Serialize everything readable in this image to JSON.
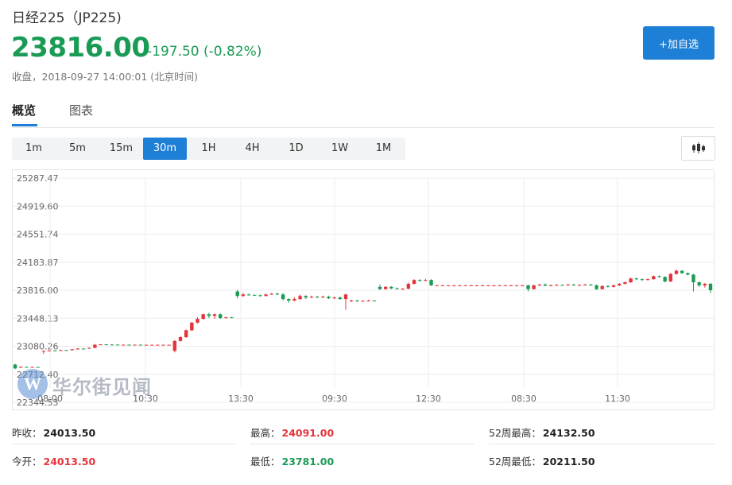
{
  "header": {
    "title": "日经225（JP225)",
    "price": "23816.00",
    "change": "-197.50 (-0.82%)",
    "status_label": "收盘，",
    "timestamp": "2018-09-27 14:00:01",
    "timezone": "(北京时间)",
    "add_watch_label": "+加自选",
    "change_color": "#1a9b55",
    "accent_color": "#1e7fd6"
  },
  "tabs": [
    {
      "label": "概览",
      "active": true
    },
    {
      "label": "图表",
      "active": false
    }
  ],
  "periods": [
    "1m",
    "5m",
    "15m",
    "30m",
    "1H",
    "4H",
    "1D",
    "1W",
    "1M"
  ],
  "active_period": "30m",
  "chart_type_icon": "candlestick-icon",
  "watermark": {
    "logo_letter": "W",
    "text": "华尔街见闻"
  },
  "chart_data": {
    "type": "candlestick",
    "y_ticks": [
      "25287.47",
      "24919.60",
      "24551.74",
      "24183.87",
      "23816.00",
      "23448.13",
      "23080.26",
      "22712.40",
      "22344.53"
    ],
    "ylim": [
      22344.53,
      25287.47
    ],
    "x_ticks": [
      "08:00",
      "10:30",
      "13:30",
      "09:30",
      "12:30",
      "08:30",
      "11:30"
    ],
    "grid": true,
    "up_color": "#e5343b",
    "down_color": "#1a9b55",
    "candles": [
      {
        "o": 22840,
        "c": 22790,
        "h": 22850,
        "l": 22780
      },
      {
        "o": 22800,
        "c": 22810,
        "h": 22815,
        "l": 22795
      },
      {
        "o": 22810,
        "c": 22805,
        "h": 22812,
        "l": 22800
      },
      {
        "o": 22805,
        "c": 22808,
        "h": 22810,
        "l": 22802
      },
      {
        "o": 22808,
        "c": 22806,
        "h": 22810,
        "l": 22804
      },
      {
        "o": 23010,
        "c": 23020,
        "h": 23025,
        "l": 22980
      },
      {
        "o": 23020,
        "c": 23025,
        "h": 23030,
        "l": 23015
      },
      {
        "o": 23025,
        "c": 23022,
        "h": 23028,
        "l": 23018
      },
      {
        "o": 23022,
        "c": 23030,
        "h": 23035,
        "l": 23020
      },
      {
        "o": 23030,
        "c": 23028,
        "h": 23032,
        "l": 23025
      },
      {
        "o": 23028,
        "c": 23040,
        "h": 23045,
        "l": 23025
      },
      {
        "o": 23040,
        "c": 23050,
        "h": 23055,
        "l": 23035
      },
      {
        "o": 23050,
        "c": 23040,
        "h": 23055,
        "l": 23038
      },
      {
        "o": 23050,
        "c": 23060,
        "h": 23065,
        "l": 23045
      },
      {
        "o": 23060,
        "c": 23100,
        "h": 23110,
        "l": 23055
      },
      {
        "o": 23100,
        "c": 23105,
        "h": 23108,
        "l": 23098
      },
      {
        "o": 23105,
        "c": 23103,
        "h": 23107,
        "l": 23100
      },
      {
        "o": 23103,
        "c": 23102,
        "h": 23105,
        "l": 23100
      },
      {
        "o": 23102,
        "c": 23100,
        "h": 23104,
        "l": 23098
      },
      {
        "o": 23100,
        "c": 23101,
        "h": 23103,
        "l": 23099
      },
      {
        "o": 23101,
        "c": 23100,
        "h": 23103,
        "l": 23098
      },
      {
        "o": 23100,
        "c": 23101,
        "h": 23102,
        "l": 23099
      },
      {
        "o": 23101,
        "c": 23100,
        "h": 23102,
        "l": 23099
      },
      {
        "o": 23100,
        "c": 23100,
        "h": 23101,
        "l": 23099
      },
      {
        "o": 23100,
        "c": 23100,
        "h": 23101,
        "l": 23099
      },
      {
        "o": 23100,
        "c": 23100,
        "h": 23101,
        "l": 23099
      },
      {
        "o": 23100,
        "c": 23100,
        "h": 23101,
        "l": 23099
      },
      {
        "o": 23100,
        "c": 23100,
        "h": 23101,
        "l": 23099
      },
      {
        "o": 23020,
        "c": 23150,
        "h": 23160,
        "l": 23000
      },
      {
        "o": 23150,
        "c": 23200,
        "h": 23210,
        "l": 23140
      },
      {
        "o": 23200,
        "c": 23290,
        "h": 23300,
        "l": 23190
      },
      {
        "o": 23290,
        "c": 23390,
        "h": 23400,
        "l": 23280
      },
      {
        "o": 23390,
        "c": 23440,
        "h": 23460,
        "l": 23380
      },
      {
        "o": 23440,
        "c": 23500,
        "h": 23510,
        "l": 23430
      },
      {
        "o": 23500,
        "c": 23480,
        "h": 23520,
        "l": 23450
      },
      {
        "o": 23480,
        "c": 23500,
        "h": 23510,
        "l": 23440
      },
      {
        "o": 23500,
        "c": 23450,
        "h": 23510,
        "l": 23440
      },
      {
        "o": 23450,
        "c": 23460,
        "h": 23465,
        "l": 23445
      },
      {
        "o": 23460,
        "c": 23455,
        "h": 23465,
        "l": 23450
      },
      {
        "o": 23800,
        "c": 23740,
        "h": 23820,
        "l": 23710
      },
      {
        "o": 23740,
        "c": 23760,
        "h": 23780,
        "l": 23730
      },
      {
        "o": 23760,
        "c": 23755,
        "h": 23770,
        "l": 23745
      },
      {
        "o": 23755,
        "c": 23750,
        "h": 23760,
        "l": 23740
      },
      {
        "o": 23750,
        "c": 23740,
        "h": 23760,
        "l": 23730
      },
      {
        "o": 23740,
        "c": 23760,
        "h": 23770,
        "l": 23735
      },
      {
        "o": 23760,
        "c": 23770,
        "h": 23780,
        "l": 23755
      },
      {
        "o": 23770,
        "c": 23760,
        "h": 23785,
        "l": 23755
      },
      {
        "o": 23760,
        "c": 23700,
        "h": 23780,
        "l": 23680
      },
      {
        "o": 23700,
        "c": 23680,
        "h": 23710,
        "l": 23650
      },
      {
        "o": 23680,
        "c": 23700,
        "h": 23720,
        "l": 23670
      },
      {
        "o": 23700,
        "c": 23740,
        "h": 23760,
        "l": 23690
      },
      {
        "o": 23740,
        "c": 23720,
        "h": 23750,
        "l": 23700
      },
      {
        "o": 23720,
        "c": 23730,
        "h": 23745,
        "l": 23710
      },
      {
        "o": 23730,
        "c": 23725,
        "h": 23740,
        "l": 23715
      },
      {
        "o": 23725,
        "c": 23730,
        "h": 23745,
        "l": 23715
      },
      {
        "o": 23730,
        "c": 23710,
        "h": 23745,
        "l": 23700
      },
      {
        "o": 23710,
        "c": 23720,
        "h": 23730,
        "l": 23700
      },
      {
        "o": 23720,
        "c": 23700,
        "h": 23735,
        "l": 23690
      },
      {
        "o": 23700,
        "c": 23760,
        "h": 23770,
        "l": 23560
      },
      {
        "o": 23670,
        "c": 23680,
        "h": 23690,
        "l": 23660
      },
      {
        "o": 23680,
        "c": 23670,
        "h": 23690,
        "l": 23665
      },
      {
        "o": 23670,
        "c": 23675,
        "h": 23685,
        "l": 23665
      },
      {
        "o": 23675,
        "c": 23680,
        "h": 23690,
        "l": 23670
      },
      {
        "o": 23680,
        "c": 23678,
        "h": 23685,
        "l": 23675
      },
      {
        "o": 23860,
        "c": 23830,
        "h": 23890,
        "l": 23820
      },
      {
        "o": 23830,
        "c": 23860,
        "h": 23870,
        "l": 23825
      },
      {
        "o": 23860,
        "c": 23840,
        "h": 23870,
        "l": 23830
      },
      {
        "o": 23840,
        "c": 23830,
        "h": 23850,
        "l": 23825
      },
      {
        "o": 23830,
        "c": 23835,
        "h": 23845,
        "l": 23825
      },
      {
        "o": 23835,
        "c": 23900,
        "h": 23915,
        "l": 23830
      },
      {
        "o": 23900,
        "c": 23950,
        "h": 23960,
        "l": 23890
      },
      {
        "o": 23950,
        "c": 23940,
        "h": 23960,
        "l": 23930
      },
      {
        "o": 23940,
        "c": 23950,
        "h": 23965,
        "l": 23935
      },
      {
        "o": 23950,
        "c": 23880,
        "h": 23960,
        "l": 23870
      },
      {
        "o": 23880,
        "c": 23880,
        "h": 23885,
        "l": 23875
      },
      {
        "o": 23880,
        "c": 23880,
        "h": 23885,
        "l": 23875
      },
      {
        "o": 23880,
        "c": 23880,
        "h": 23885,
        "l": 23875
      },
      {
        "o": 23880,
        "c": 23880,
        "h": 23885,
        "l": 23875
      },
      {
        "o": 23880,
        "c": 23880,
        "h": 23885,
        "l": 23875
      },
      {
        "o": 23880,
        "c": 23880,
        "h": 23885,
        "l": 23875
      },
      {
        "o": 23880,
        "c": 23880,
        "h": 23885,
        "l": 23875
      },
      {
        "o": 23880,
        "c": 23880,
        "h": 23885,
        "l": 23875
      },
      {
        "o": 23880,
        "c": 23880,
        "h": 23885,
        "l": 23875
      },
      {
        "o": 23880,
        "c": 23880,
        "h": 23885,
        "l": 23875
      },
      {
        "o": 23880,
        "c": 23880,
        "h": 23885,
        "l": 23875
      },
      {
        "o": 23880,
        "c": 23880,
        "h": 23885,
        "l": 23875
      },
      {
        "o": 23880,
        "c": 23880,
        "h": 23885,
        "l": 23875
      },
      {
        "o": 23880,
        "c": 23880,
        "h": 23885,
        "l": 23875
      },
      {
        "o": 23880,
        "c": 23880,
        "h": 23885,
        "l": 23875
      },
      {
        "o": 23880,
        "c": 23880,
        "h": 23885,
        "l": 23875
      },
      {
        "o": 23880,
        "c": 23830,
        "h": 23890,
        "l": 23800
      },
      {
        "o": 23830,
        "c": 23880,
        "h": 23890,
        "l": 23825
      },
      {
        "o": 23880,
        "c": 23890,
        "h": 23900,
        "l": 23870
      },
      {
        "o": 23890,
        "c": 23875,
        "h": 23905,
        "l": 23870
      },
      {
        "o": 23875,
        "c": 23880,
        "h": 23890,
        "l": 23870
      },
      {
        "o": 23880,
        "c": 23885,
        "h": 23895,
        "l": 23875
      },
      {
        "o": 23885,
        "c": 23880,
        "h": 23890,
        "l": 23875
      },
      {
        "o": 23880,
        "c": 23890,
        "h": 23900,
        "l": 23875
      },
      {
        "o": 23890,
        "c": 23880,
        "h": 23900,
        "l": 23875
      },
      {
        "o": 23880,
        "c": 23885,
        "h": 23895,
        "l": 23875
      },
      {
        "o": 23885,
        "c": 23890,
        "h": 23900,
        "l": 23880
      },
      {
        "o": 23890,
        "c": 23880,
        "h": 23900,
        "l": 23875
      },
      {
        "o": 23880,
        "c": 23830,
        "h": 23890,
        "l": 23820
      },
      {
        "o": 23830,
        "c": 23870,
        "h": 23880,
        "l": 23825
      },
      {
        "o": 23870,
        "c": 23860,
        "h": 23880,
        "l": 23850
      },
      {
        "o": 23860,
        "c": 23880,
        "h": 23890,
        "l": 23850
      },
      {
        "o": 23880,
        "c": 23900,
        "h": 23910,
        "l": 23870
      },
      {
        "o": 23900,
        "c": 23920,
        "h": 23930,
        "l": 23890
      },
      {
        "o": 23920,
        "c": 23970,
        "h": 23980,
        "l": 23910
      },
      {
        "o": 23970,
        "c": 23960,
        "h": 23980,
        "l": 23950
      },
      {
        "o": 23960,
        "c": 23950,
        "h": 23970,
        "l": 23940
      },
      {
        "o": 23950,
        "c": 23960,
        "h": 23970,
        "l": 23945
      },
      {
        "o": 23960,
        "c": 24000,
        "h": 24010,
        "l": 23955
      },
      {
        "o": 24000,
        "c": 23990,
        "h": 24010,
        "l": 23980
      },
      {
        "o": 23990,
        "c": 23930,
        "h": 24000,
        "l": 23920
      },
      {
        "o": 23930,
        "c": 24030,
        "h": 24040,
        "l": 23925
      },
      {
        "o": 24030,
        "c": 24070,
        "h": 24091,
        "l": 24020
      },
      {
        "o": 24070,
        "c": 24040,
        "h": 24080,
        "l": 24030
      },
      {
        "o": 24040,
        "c": 24020,
        "h": 24050,
        "l": 24010
      },
      {
        "o": 24020,
        "c": 23920,
        "h": 24030,
        "l": 23800
      },
      {
        "o": 23920,
        "c": 23880,
        "h": 23930,
        "l": 23860
      },
      {
        "o": 23880,
        "c": 23900,
        "h": 23910,
        "l": 23850
      },
      {
        "o": 23900,
        "c": 23816,
        "h": 23910,
        "l": 23781
      }
    ]
  },
  "stats": {
    "prev_close_label": "昨收：",
    "prev_close": "24013.50",
    "open_label": "今开：",
    "open": "24013.50",
    "high_label": "最高：",
    "high": "24091.00",
    "low_label": "最低：",
    "low": "23781.00",
    "wk52_high_label": "52周最高：",
    "wk52_high": "24132.50",
    "wk52_low_label": "52周最低：",
    "wk52_low": "20211.50"
  }
}
